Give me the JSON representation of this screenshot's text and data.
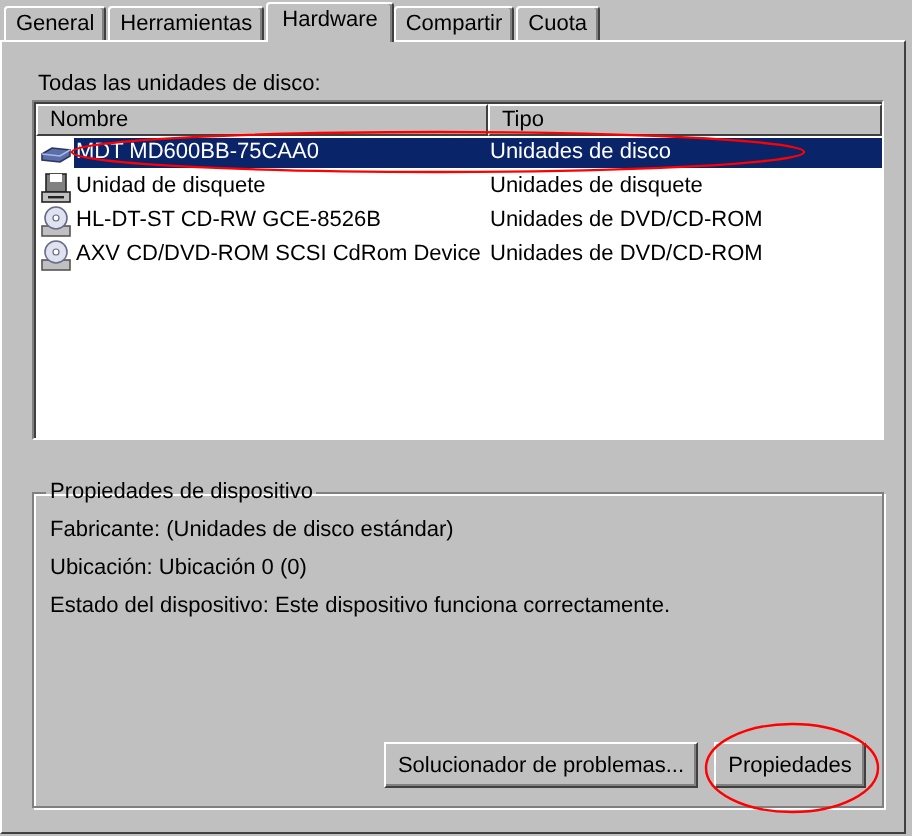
{
  "tabs": [
    {
      "label": "General",
      "selected": false
    },
    {
      "label": "Herramientas",
      "selected": false
    },
    {
      "label": "Hardware",
      "selected": true
    },
    {
      "label": "Compartir",
      "selected": false
    },
    {
      "label": "Cuota",
      "selected": false
    }
  ],
  "devices_label": "Todas las unidades de disco:",
  "table": {
    "columns": [
      "Nombre",
      "Tipo"
    ],
    "rows": [
      {
        "kind": "disk",
        "name": "MDT MD600BB-75CAA0",
        "type": "Unidades de disco",
        "selected": true
      },
      {
        "kind": "floppy",
        "name": "Unidad de disquete",
        "type": "Unidades de disquete",
        "selected": false
      },
      {
        "kind": "cdrom",
        "name": "HL-DT-ST CD-RW GCE-8526B",
        "type": "Unidades de DVD/CD-ROM",
        "selected": false
      },
      {
        "kind": "cdrom",
        "name": "AXV CD/DVD-ROM SCSI CdRom Device",
        "type": "Unidades de DVD/CD-ROM",
        "selected": false
      }
    ]
  },
  "properties": {
    "title": "Propiedades de dispositivo",
    "lines": [
      "Fabricante: (Unidades de disco estándar)",
      "Ubicación: Ubicación 0 (0)",
      "Estado del dispositivo: Este dispositivo funciona correctamente."
    ],
    "buttons": [
      "Solucionador de problemas...",
      "Propiedades"
    ]
  }
}
